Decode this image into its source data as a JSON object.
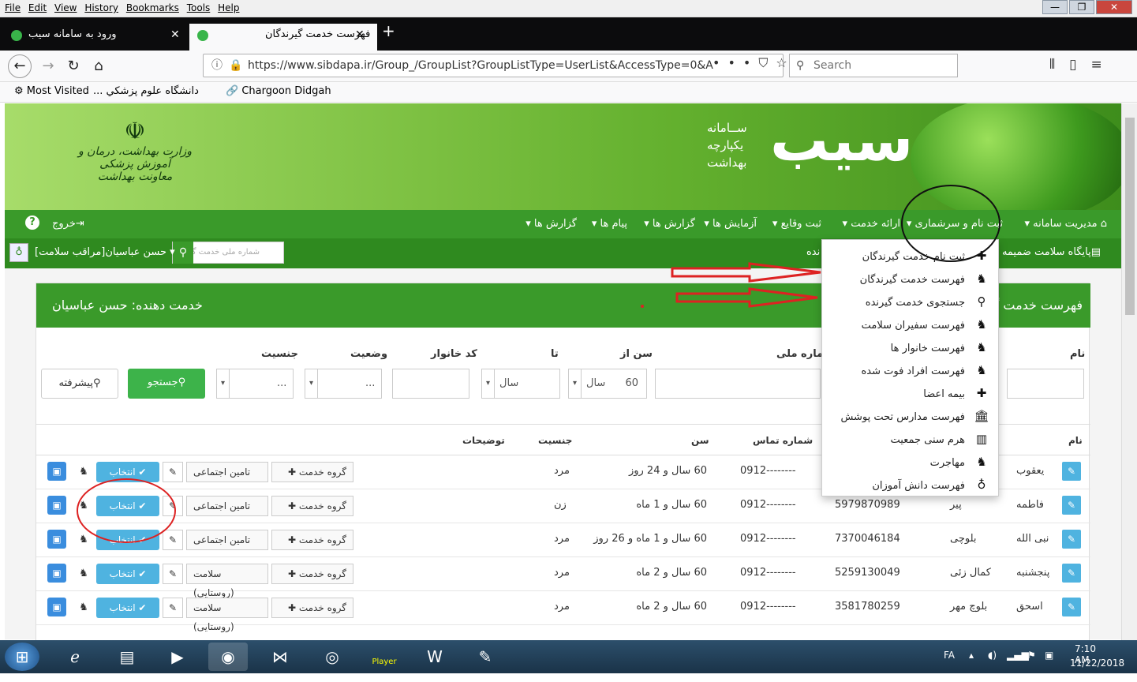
{
  "menubar": {
    "items": [
      "File",
      "Edit",
      "View",
      "History",
      "Bookmarks",
      "Tools",
      "Help"
    ]
  },
  "tabs": [
    {
      "label": "ورود به سامانه سیب"
    },
    {
      "label": "فهرست خدمت گیرندگان"
    }
  ],
  "nav": {
    "url": "https://www.sibdapa.ir/Group_/GroupList?GroupListType=UserList&AccessType=0&A",
    "search_placeholder": "Search"
  },
  "bookmarks": {
    "most_visited": "Most Visited",
    "item2": "دانشگاه علوم پزشکي ...",
    "item3": "Chargoon Didgah"
  },
  "banner": {
    "emblem_line1": "وزارت بهداشت، درمان و آموزش پزشکی",
    "emblem_line2": "معاونت بهداشت",
    "logo_big": "سیب",
    "logo_s1": "ســامانه",
    "logo_s2": "یکپارچه",
    "logo_s3": "بهداشت"
  },
  "mainmenu": {
    "home": "مدیریت سامانه",
    "register": "ثبت نام و سرشماری",
    "service": "ارائه خدمت",
    "events": "ثبت وقایع",
    "tests": "آزمایش ها",
    "reports": "گزارش ها",
    "messages": "پیام ها",
    "reports2": "گزارش ها",
    "exit": "خروج"
  },
  "subbar": {
    "base": "پایگاه سلامت ضمیمه ش",
    "user": "حسن عباسیان[مراقب سلامت]",
    "search_placeholder": "شماره ملی خدمت گیرنده",
    "partial": "نده"
  },
  "panel": {
    "title_right": "فهرست خدمت گ",
    "title_left": "خدمت دهنده: حسن عباسیان"
  },
  "filters": {
    "name": "نام",
    "national": "شماره ملی",
    "age_from": "سن از",
    "to": "تا",
    "family_code": "کد خانوار",
    "status": "وضعیت",
    "gender": "جنسیت",
    "age_value": "60",
    "unit": "سال",
    "dots": "...",
    "search_btn": "جستجو",
    "advanced_btn": "پیشرفته"
  },
  "table": {
    "headers": {
      "name": "نام",
      "phone": "شماره تماس",
      "age": "سن",
      "gender": "جنسیت",
      "desc": "توضیحات"
    },
    "group_btn": "گروه خدمت",
    "select_btn": "انتخاب",
    "rows": [
      {
        "first": "یعقوب",
        "last": "",
        "national": "",
        "phone": "0912--------",
        "age": "60 سال و 24 روز",
        "gender": "مرد",
        "insurance": "تامین اجتماعی"
      },
      {
        "first": "فاطمه",
        "last": "پیر",
        "national": "5979870989",
        "phone": "0912--------",
        "age": "60 سال و 1 ماه",
        "gender": "زن",
        "insurance": "تامین اجتماعی"
      },
      {
        "first": "نبی الله",
        "last": "بلوچی",
        "national": "7370046184",
        "phone": "0912--------",
        "age": "60 سال و 1 ماه و 26 روز",
        "gender": "مرد",
        "insurance": "تامین اجتماعی"
      },
      {
        "first": "پنجشنبه",
        "last": "کمال زئی",
        "national": "5259130049",
        "phone": "0912--------",
        "age": "60 سال و 2 ماه",
        "gender": "مرد",
        "insurance": "سلامت (روستایی)"
      },
      {
        "first": "اسحق",
        "last": "بلوچ مهر",
        "national": "3581780259",
        "phone": "0912--------",
        "age": "60 سال و 2 ماه",
        "gender": "مرد",
        "insurance": "سلامت (روستایی)"
      }
    ]
  },
  "dropdown": {
    "items": [
      "ثبت نام خدمت گیرندگان",
      "فهرست خدمت گیرندگان",
      "جستجوی خدمت گیرنده",
      "فهرست سفیران سلامت",
      "فهرست خانوار ها",
      "فهرست افراد فوت شده",
      "بیمه اعضا",
      "فهرست مدارس تحت پوشش",
      "هرم سنی جمعیت",
      "مهاجرت",
      "فهرست دانش آموزان"
    ]
  },
  "taskbar": {
    "lang": "FA",
    "time": "7:10 AM",
    "date": "11/22/2018",
    "player": "Player"
  }
}
